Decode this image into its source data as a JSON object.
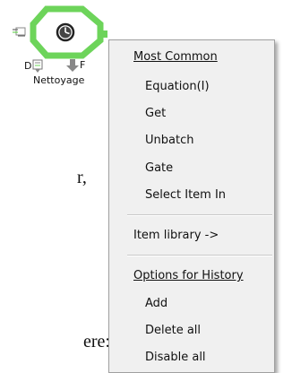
{
  "document": {
    "fragment_1": "r,",
    "fragment_2": "ere:"
  },
  "block": {
    "label": "Nettoyage",
    "port_d": "D",
    "port_f": "F",
    "icon": "clock-icon",
    "accent": "#6dd45a"
  },
  "context_menu": {
    "section_common": "Most Common",
    "common_items": [
      "Equation(I)",
      "Get",
      "Unbatch",
      "Gate",
      "Select Item In"
    ],
    "item_library": "Item library ->",
    "section_history": "Options for History",
    "history_items": [
      "Add",
      "Delete all",
      "Disable all"
    ]
  }
}
